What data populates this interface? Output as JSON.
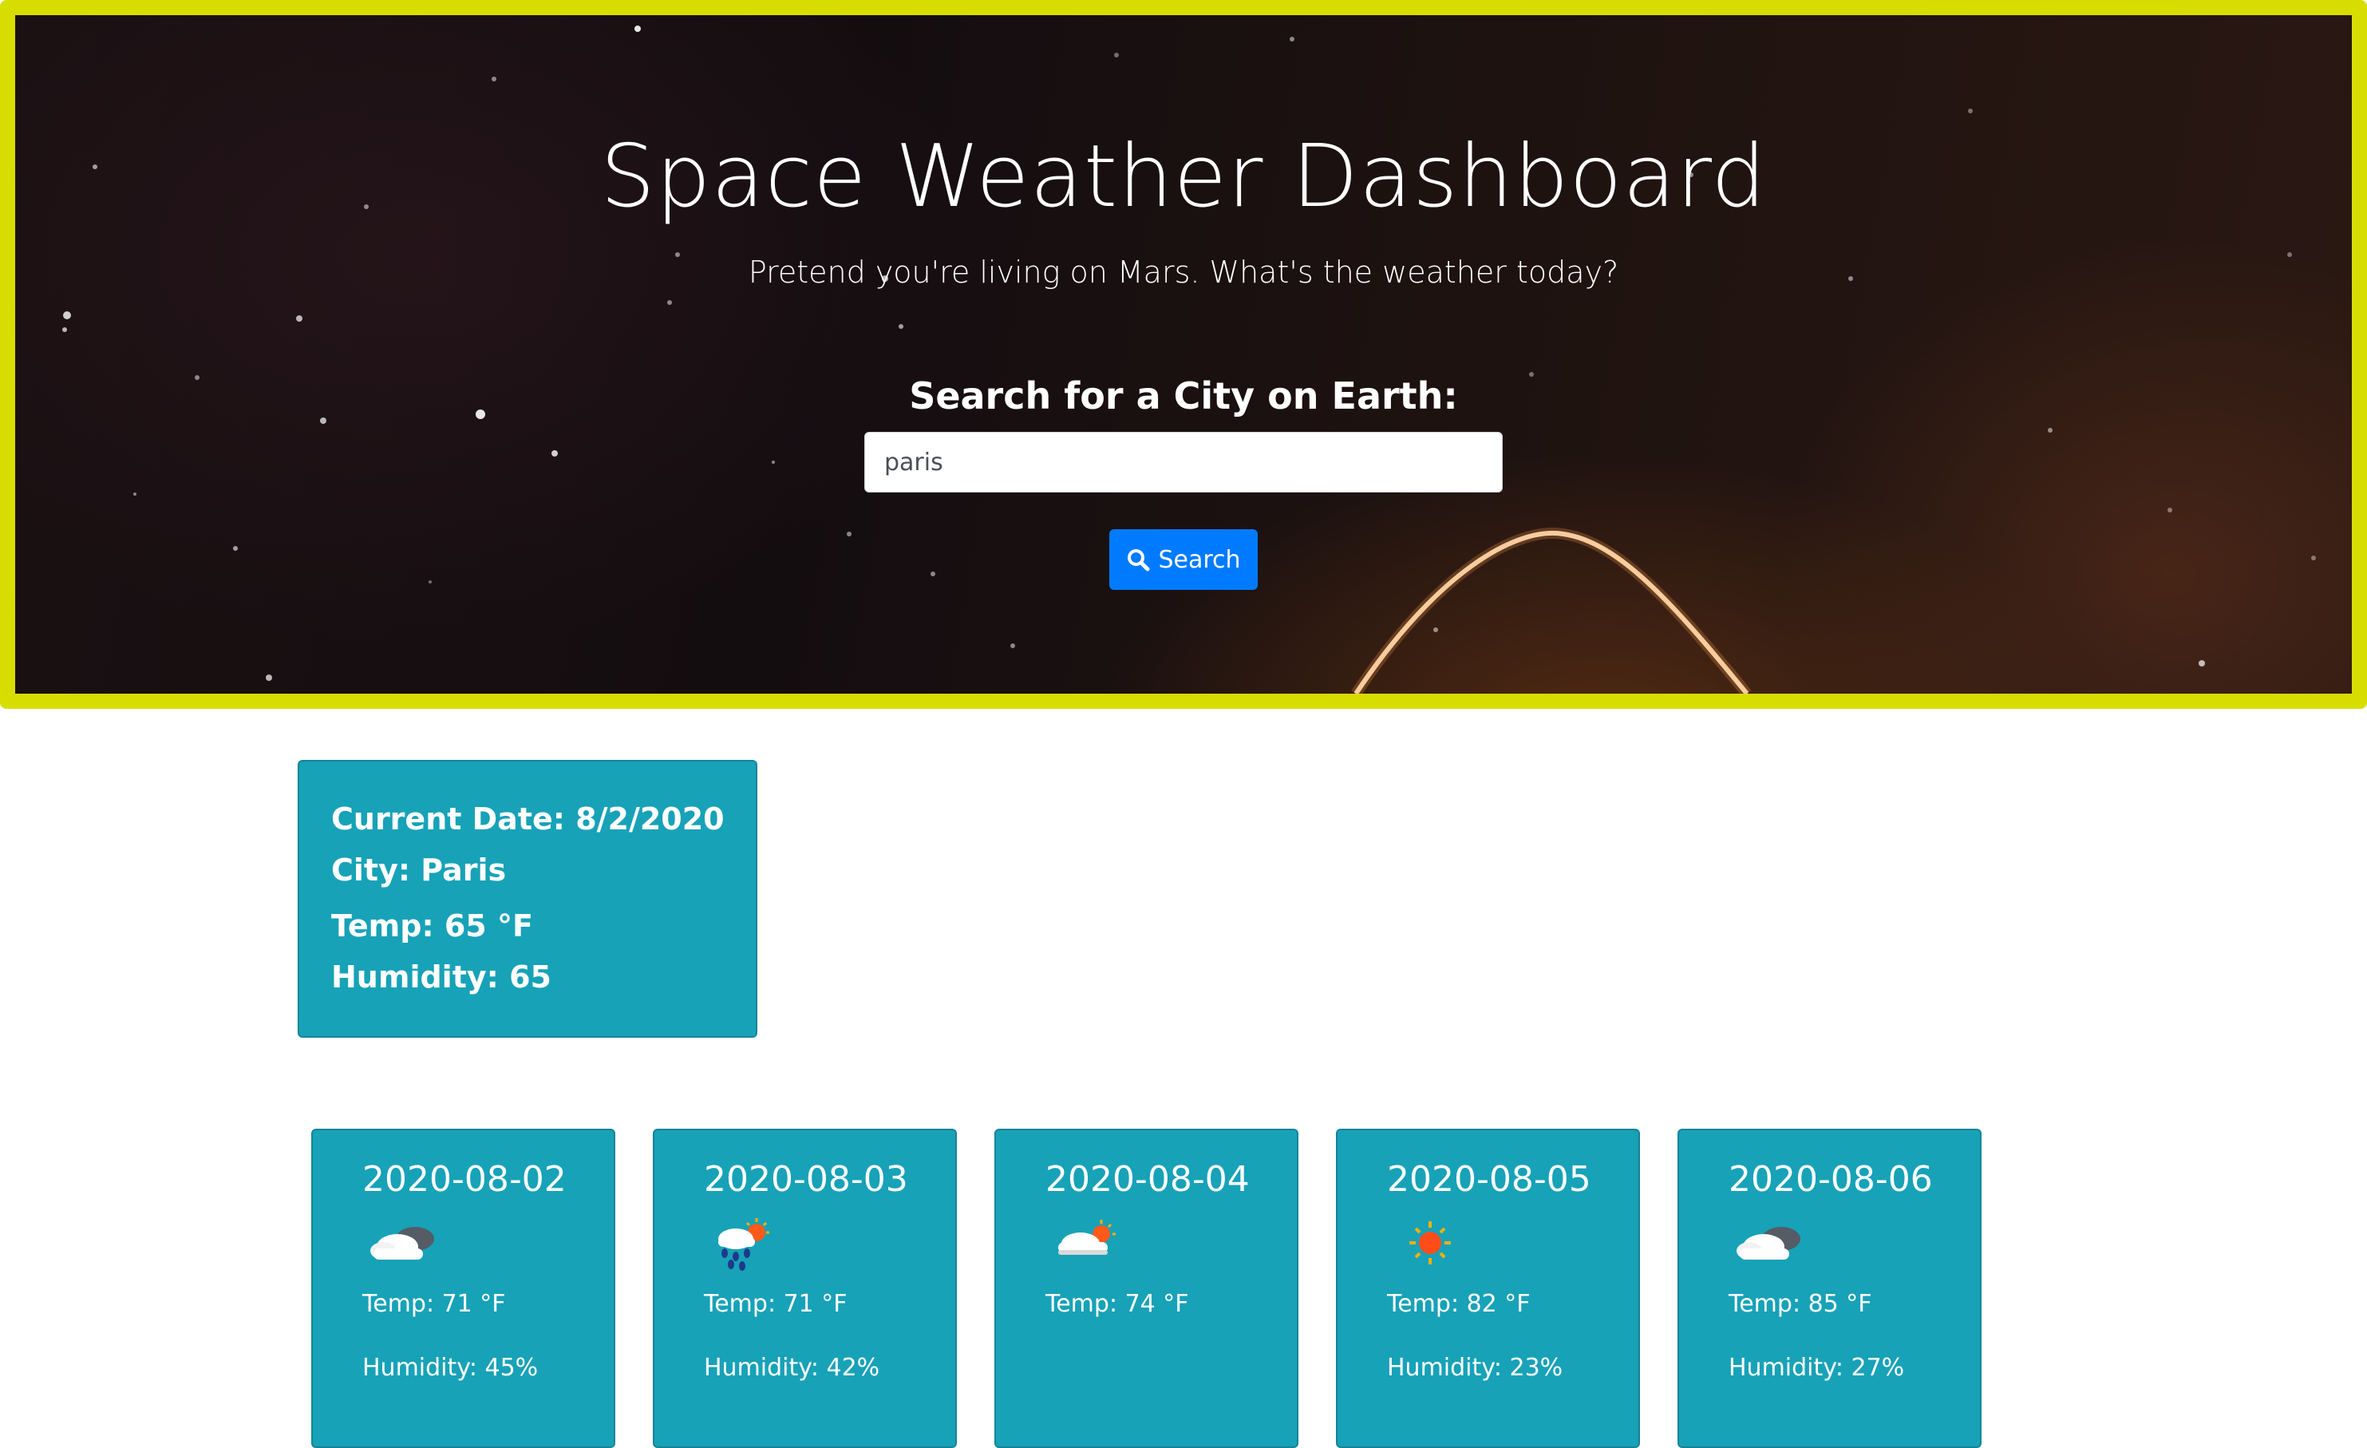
{
  "header": {
    "title": "Space Weather Dashboard",
    "subtitle": "Pretend you're living on Mars. What's the weather today?",
    "search_label": "Search for a City on Earth:",
    "search_value": "paris",
    "search_button_label": "Search",
    "border_color": "#d8dd00",
    "button_color": "#007bff"
  },
  "current": {
    "date_line": "Current Date: 8/2/2020",
    "city_line": "City: Paris",
    "temp_line": "Temp: 65 °F",
    "humidity_line": "Humidity: 65",
    "card_color": "#17a2b8"
  },
  "forecast": [
    {
      "date": "2020-08-02",
      "icon": "cloud-icon",
      "temp": "Temp: 71 °F",
      "humidity": "Humidity: 45%"
    },
    {
      "date": "2020-08-03",
      "icon": "rain-sun-icon",
      "temp": "Temp: 71 °F",
      "humidity": "Humidity: 42%"
    },
    {
      "date": "2020-08-04",
      "icon": "partly-cloudy-icon",
      "temp": "Temp: 74 °F",
      "humidity": ""
    },
    {
      "date": "2020-08-05",
      "icon": "sun-icon",
      "temp": "Temp: 82 °F",
      "humidity": "Humidity: 23%"
    },
    {
      "date": "2020-08-06",
      "icon": "cloud-icon",
      "temp": "Temp: 85 °F",
      "humidity": "Humidity: 27%"
    }
  ]
}
